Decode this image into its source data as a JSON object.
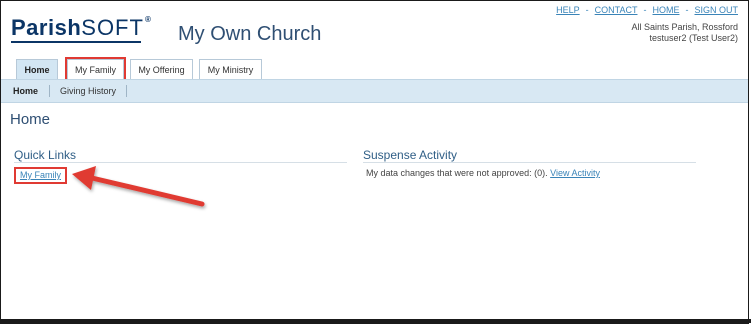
{
  "header": {
    "logo_brand": "Parish",
    "logo_brand_suffix": "SOFT",
    "site_title": "My Own Church",
    "top_links": [
      "HELP",
      "CONTACT",
      "HOME",
      "SIGN OUT"
    ],
    "separator": "-",
    "parish_name": "All Saints Parish, Rossford",
    "user_label": "testuser2 (Test User2)"
  },
  "tabs": [
    {
      "label": "Home",
      "active": true
    },
    {
      "label": "My Family",
      "highlighted": true
    },
    {
      "label": "My Offering"
    },
    {
      "label": "My Ministry"
    }
  ],
  "subnav": {
    "items": [
      {
        "label": "Home",
        "active": true
      },
      {
        "label": "Giving History"
      }
    ]
  },
  "page": {
    "title": "Home",
    "quick_links": {
      "title": "Quick Links",
      "links": [
        "My Family"
      ]
    },
    "suspense": {
      "title": "Suspense Activity",
      "text": "My data changes that were not approved: (0).",
      "link": "View Activity"
    }
  },
  "annotation": {
    "highlight_color": "#e03a33"
  },
  "colors": {
    "brand": "#0b3566",
    "link": "#3a84b8",
    "subnav_bg": "#d8e8f3"
  }
}
